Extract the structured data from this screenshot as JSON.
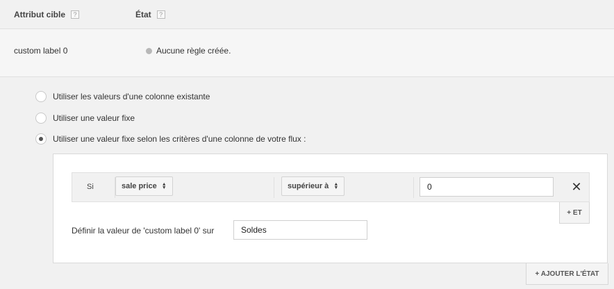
{
  "header": {
    "col_attr": "Attribut cible",
    "col_state": "État",
    "help_glyph": "?"
  },
  "row": {
    "attribute": "custom label 0",
    "state": "Aucune règle créée."
  },
  "options": [
    {
      "label": "Utiliser les valeurs d'une colonne existante",
      "checked": false
    },
    {
      "label": "Utiliser une valeur fixe",
      "checked": false
    },
    {
      "label": "Utiliser une valeur fixe selon les critères d'une colonne de votre flux :",
      "checked": true
    }
  ],
  "condition": {
    "si_label": "Si",
    "column_value": "sale price",
    "operator_value": "supérieur à",
    "input_value": "0",
    "remove_glyph": "✕"
  },
  "buttons": {
    "and_label": "+ ET",
    "add_state_label": "+ AJOUTER L'ÉTAT"
  },
  "define": {
    "label": "Définir la valeur de 'custom label 0' sur",
    "value": "Soldes"
  },
  "colors": {
    "background": "#f1f1f1",
    "panel": "#ffffff",
    "status_dot": "#b8b8b8"
  }
}
